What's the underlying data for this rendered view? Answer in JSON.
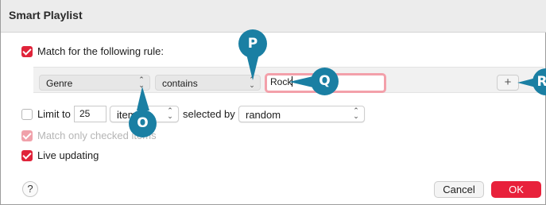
{
  "window": {
    "title": "Smart Playlist"
  },
  "match_rule": {
    "checked": true,
    "label": "Match for the following rule:"
  },
  "rule": {
    "field": "Genre",
    "operator": "contains",
    "value": "Rock",
    "add_label": "+"
  },
  "limit": {
    "checked": false,
    "label": "Limit to",
    "count": "25",
    "unit": "items",
    "selected_by_label": "selected by",
    "selected_by_value": "random"
  },
  "match_checked": {
    "checked": true,
    "enabled": false,
    "label": "Match only checked items"
  },
  "live_updating": {
    "checked": true,
    "label": "Live updating"
  },
  "footer": {
    "help_label": "?",
    "cancel_label": "Cancel",
    "ok_label": "OK"
  },
  "callouts": {
    "o": "O",
    "p": "P",
    "q": "Q",
    "r": "R"
  },
  "colors": {
    "accent": "#e0243a",
    "callout": "#1a7fa3"
  }
}
